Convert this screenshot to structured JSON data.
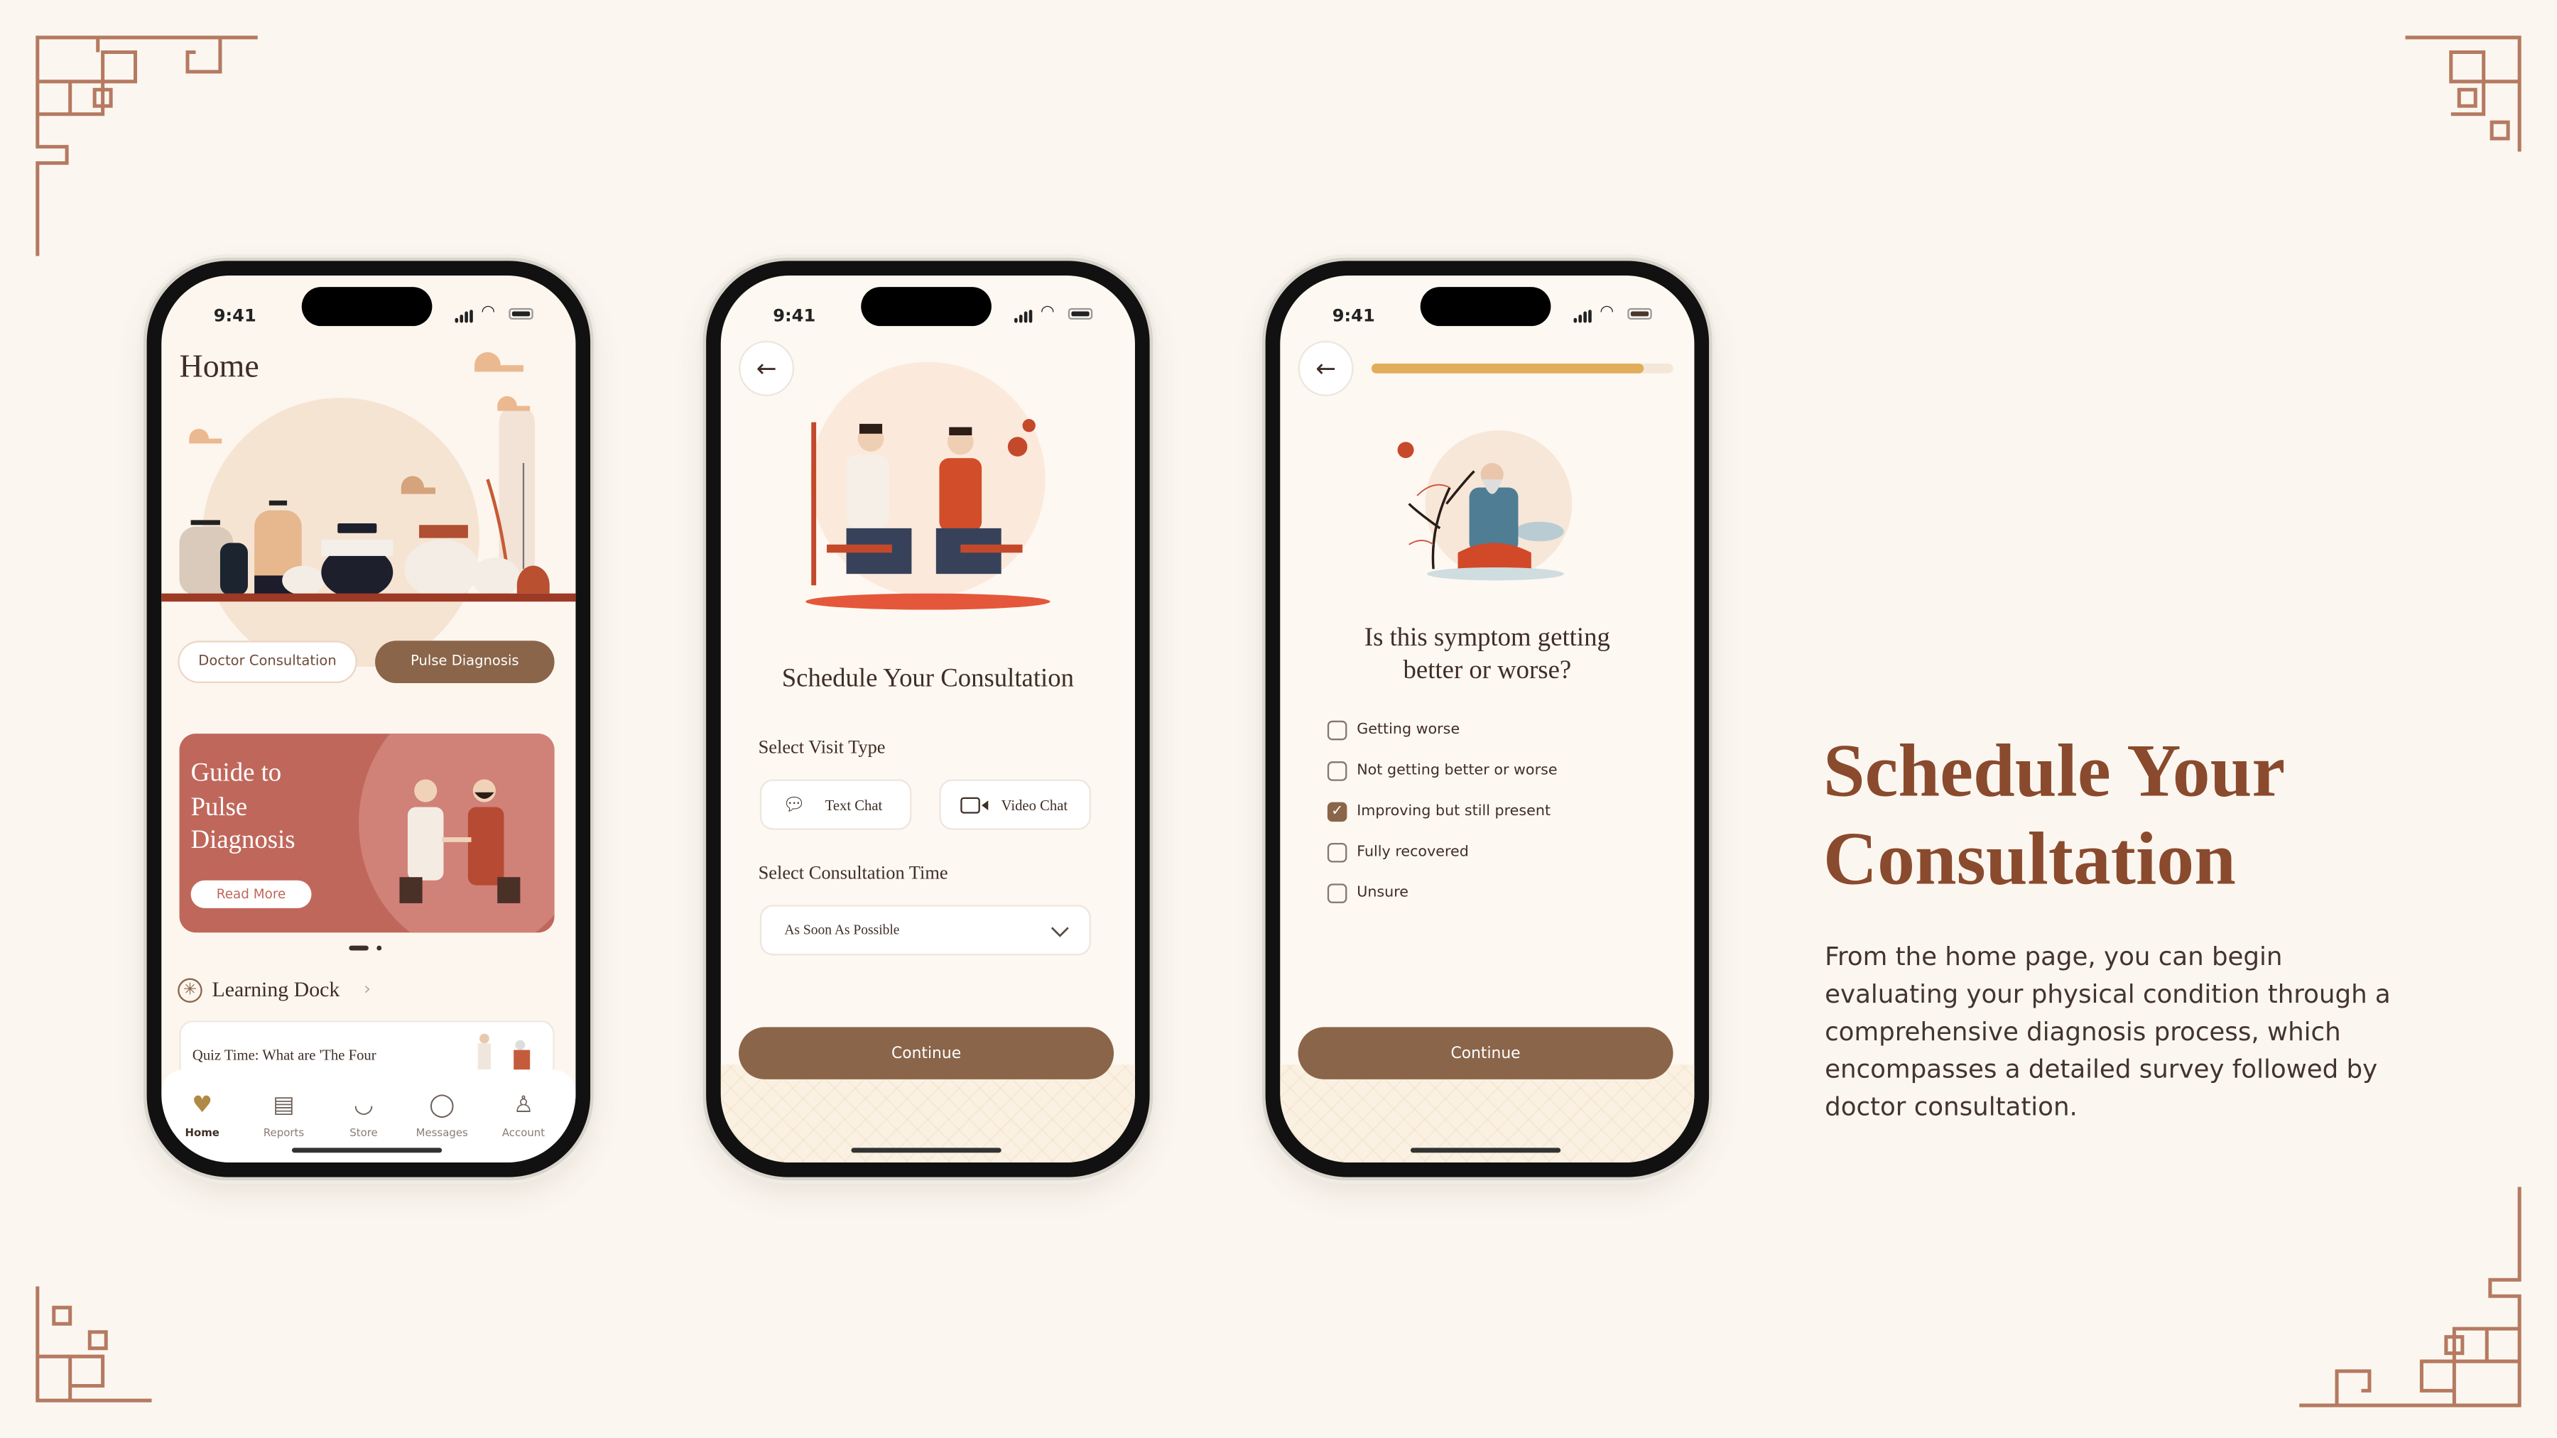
{
  "colors": {
    "background": "#fbf7f0",
    "accent_brown": "#8a6549",
    "title_brown": "#8a4a2e",
    "banner": "#c0675b",
    "progress": "#e2ad5a",
    "ornament": "#b57a61"
  },
  "status_bar": {
    "time": "9:41"
  },
  "home_screen": {
    "title": "Home",
    "chips": [
      {
        "label": "Doctor Consultation",
        "selected": false
      },
      {
        "label": "Pulse Diagnosis",
        "selected": true
      }
    ],
    "banner": {
      "title_lines": [
        "Guide to",
        "Pulse",
        "Diagnosis"
      ],
      "button": "Read More"
    },
    "carousel": {
      "pages": 2,
      "active": 1
    },
    "section": {
      "title": "Learning Dock",
      "chevron": "›"
    },
    "quiz_card": {
      "title": "Quiz Time: What are 'The Four Diagnostic Methods'?"
    },
    "tabs": [
      {
        "label": "Home",
        "icon": "heart-pulse-icon",
        "active": true
      },
      {
        "label": "Reports",
        "icon": "clipboard-icon"
      },
      {
        "label": "Store",
        "icon": "mortar-pestle-icon"
      },
      {
        "label": "Messages",
        "icon": "chat-bubbles-icon"
      },
      {
        "label": "Account",
        "icon": "user-icon"
      }
    ]
  },
  "schedule_screen": {
    "back_icon": "arrow-left-icon",
    "title": "Schedule Your Consultation",
    "visit_type_label": "Select Visit Type",
    "visit_types": [
      {
        "label": "Text Chat",
        "icon": "chat-dots-icon"
      },
      {
        "label": "Video Chat",
        "icon": "video-camera-icon"
      }
    ],
    "time_label": "Select Consultation Time",
    "time_value": "As Soon As Possible",
    "continue": "Continue"
  },
  "survey_screen": {
    "back_icon": "arrow-left-icon",
    "progress_percent": 90,
    "question_lines": [
      "Is this symptom getting",
      "better or worse?"
    ],
    "options": [
      {
        "label": "Getting worse",
        "checked": false
      },
      {
        "label": "Not getting better or worse",
        "checked": false
      },
      {
        "label": "Improving but still present",
        "checked": true
      },
      {
        "label": "Fully recovered",
        "checked": false
      },
      {
        "label": "Unsure",
        "checked": false
      }
    ],
    "continue": "Continue"
  },
  "side_panel": {
    "title_lines": [
      "Schedule Your",
      "Consultation"
    ],
    "description": "From the home page, you can begin evaluating your physical condition through a comprehensive diagnosis process, which encompasses a detailed survey followed by doctor consultation."
  }
}
